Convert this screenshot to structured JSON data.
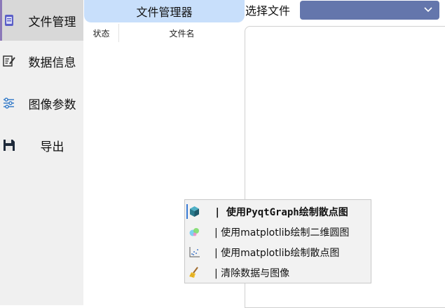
{
  "sidebar": {
    "items": [
      {
        "label": "文件管理",
        "icon": "document-icon",
        "active": true
      },
      {
        "label": "数据信息",
        "icon": "edit-note-icon",
        "active": false
      },
      {
        "label": "图像参数",
        "icon": "sliders-icon",
        "active": false
      },
      {
        "label": "导出",
        "icon": "save-icon",
        "active": false
      }
    ]
  },
  "file_manager": {
    "title": "文件管理器",
    "columns": [
      "状态",
      "文件名"
    ]
  },
  "file_select": {
    "label": "选择文件",
    "value": ""
  },
  "context_menu": {
    "items": [
      {
        "label": "| 使用PyqtGraph绘制散点图",
        "icon": "cube-icon"
      },
      {
        "label": "| 使用matplotlib绘制二维圆图",
        "icon": "circles-icon"
      },
      {
        "label": "| 使用matplotlib绘制散点图",
        "icon": "scatter-icon"
      },
      {
        "label": "| 清除数据与图像",
        "icon": "broom-icon"
      }
    ]
  },
  "colors": {
    "accent": "#8b78b8",
    "title_bg": "#c8dffb",
    "select_bg": "#6476ac",
    "sidebar_bg": "#f0f0f0"
  }
}
